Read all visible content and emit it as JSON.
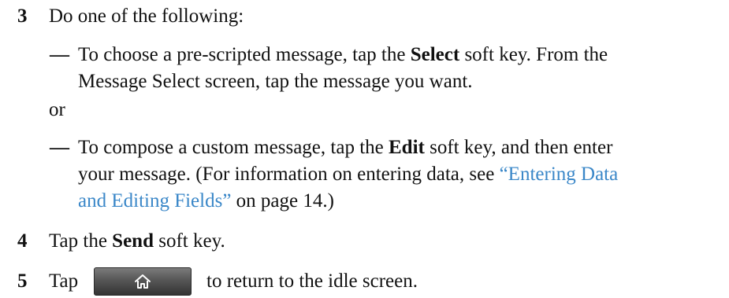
{
  "steps": {
    "s3": {
      "number": "3",
      "text": "Do one of the following:"
    },
    "bullet1": {
      "dash": "—",
      "pre": "To choose a pre-scripted message, tap the ",
      "key": "Select",
      "post": " soft key. From the",
      "line2": "Message Select screen, tap the message you want."
    },
    "or": "or",
    "bullet2": {
      "dash": "—",
      "pre": "To compose a custom message, tap the ",
      "key": "Edit",
      "post": " soft key, and then enter",
      "line2_pre": "your message. (For information on entering data, see ",
      "link1": "“Entering Data",
      "link2": "and Editing Fields”",
      "line3_post": " on page 14.)"
    },
    "s4": {
      "number": "4",
      "pre": "Tap the ",
      "key": "Send",
      "post": " soft key."
    },
    "s5": {
      "number": "5",
      "pre": "Tap",
      "post": "to return to the idle screen."
    }
  },
  "icons": {
    "home": "home-icon"
  }
}
